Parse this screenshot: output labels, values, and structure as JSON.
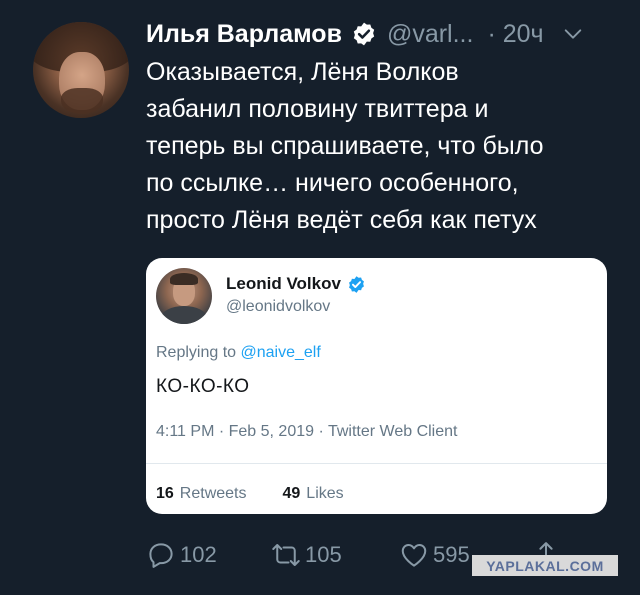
{
  "tweet": {
    "author_name": "Илья Варламов",
    "handle": "@varl...",
    "time": "· 20ч",
    "text": "Оказывается, Лёня Волков\nзабанил половину твиттера и\nтеперь вы спрашиваете, что было\nпо ссылке… ничего особенного,\nпросто Лёня ведёт себя как петух",
    "actions": {
      "replies": "102",
      "retweets": "105",
      "likes": "595"
    }
  },
  "quoted": {
    "name": "Leonid Volkov",
    "handle": "@leonidvolkov",
    "replying_prefix": "Replying to ",
    "replying_mention": "@naive_elf",
    "text": "КО-КО-КО",
    "meta": "4:11 PM · Feb 5, 2019 · Twitter Web Client",
    "retweets_count": "16",
    "retweets_label": "Retweets",
    "likes_count": "49",
    "likes_label": "Likes"
  },
  "watermark": "YAPLAKAL.COM",
  "colors": {
    "background": "#151f2b",
    "muted": "#8899a6",
    "link": "#1da1f2",
    "card": "#ffffff"
  },
  "icons": [
    "verified-badge-icon",
    "chevron-down-icon",
    "reply-icon",
    "retweet-icon",
    "like-icon",
    "share-icon"
  ]
}
